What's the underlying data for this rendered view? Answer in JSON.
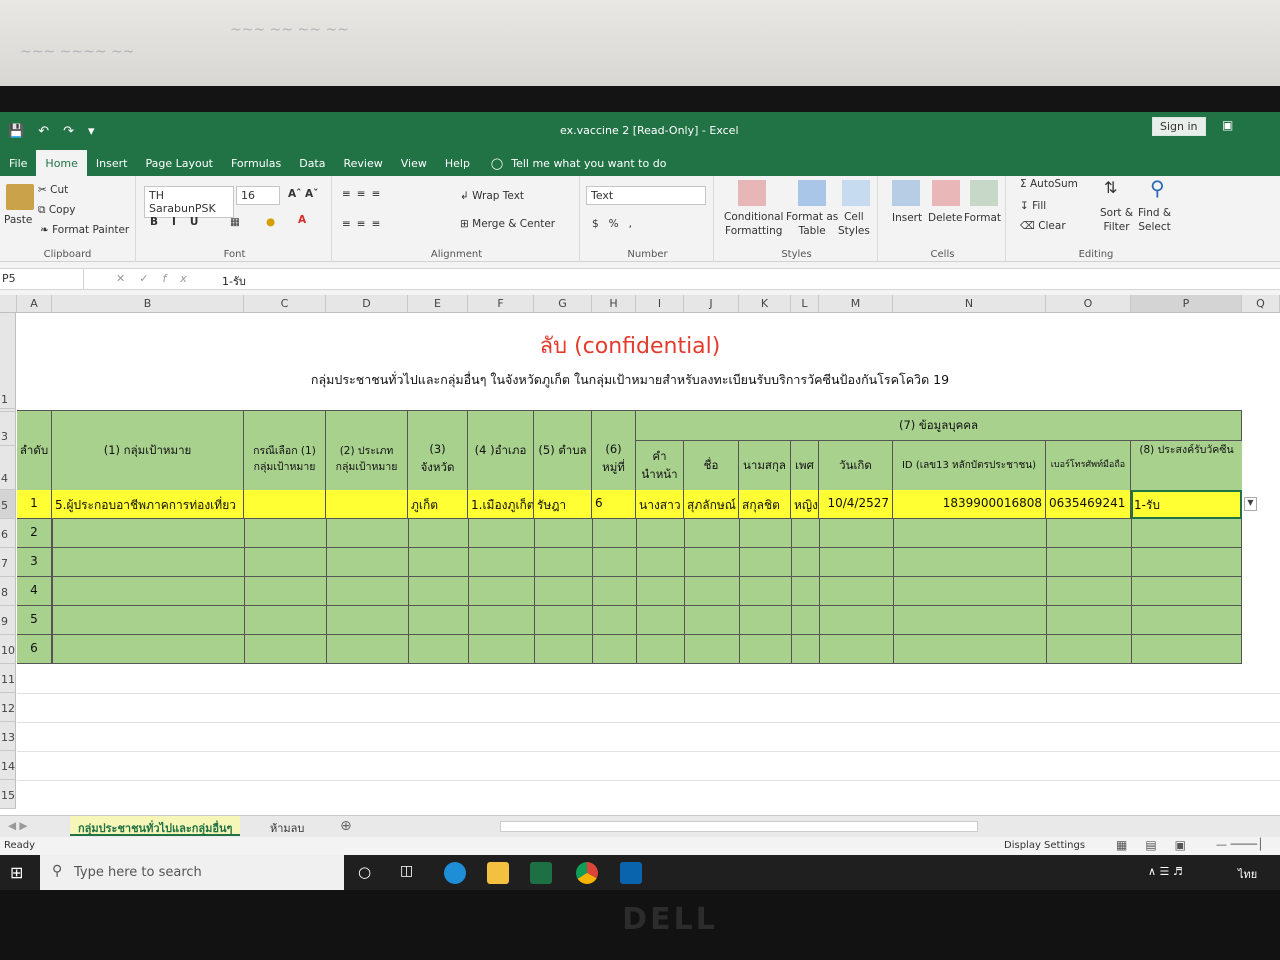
{
  "app": {
    "window_title": "ex.vaccine 2  [Read-Only]  -  Excel",
    "sign_in": "Sign in",
    "tabs": [
      "File",
      "Home",
      "Insert",
      "Page Layout",
      "Formulas",
      "Data",
      "Review",
      "View",
      "Help"
    ],
    "tell_me": "Tell me what you want to do"
  },
  "ribbon": {
    "clipboard": {
      "paste": "Paste",
      "cut": "Cut",
      "copy": "Copy",
      "format_painter": "Format Painter",
      "label": "Clipboard"
    },
    "font": {
      "name": "TH SarabunPSK",
      "size": "16",
      "label": "Font"
    },
    "alignment": {
      "wrap": "Wrap Text",
      "merge": "Merge & Center",
      "label": "Alignment"
    },
    "number": {
      "format": "Text",
      "label": "Number"
    },
    "styles": {
      "conditional_1": "Conditional",
      "conditional_2": "Formatting",
      "format_as_1": "Format as",
      "format_as_2": "Table",
      "cell_1": "Cell",
      "cell_2": "Styles",
      "label": "Styles"
    },
    "cells": {
      "insert": "Insert",
      "delete": "Delete",
      "format": "Format",
      "label": "Cells"
    },
    "editing": {
      "autosum": "AutoSum",
      "fill": "Fill",
      "clear": "Clear",
      "sort_1": "Sort &",
      "sort_2": "Filter",
      "find_1": "Find &",
      "find_2": "Select",
      "label": "Editing"
    }
  },
  "formula_bar": {
    "name_box": "P5",
    "content": "1-รับ"
  },
  "columns": [
    "A",
    "B",
    "C",
    "D",
    "E",
    "F",
    "G",
    "H",
    "I",
    "J",
    "K",
    "L",
    "M",
    "N",
    "O",
    "P",
    "Q"
  ],
  "rows": [
    "1",
    "2",
    "3",
    "4",
    "5",
    "6",
    "7",
    "8",
    "9",
    "10",
    "11",
    "12",
    "13",
    "14",
    "15"
  ],
  "sheet": {
    "title": "ลับ (confidential)",
    "subtitle": "กลุ่มประชาชนทั่วไปและกลุ่มอื่นๆ ในจังหวัดภูเก็ต ในกลุ่มเป้าหมายสำหรับลงทะเบียนรับบริการวัคซีนป้องกันโรคโควิด 19",
    "group_header": "(7) ข้อมูลบุคคล",
    "headers": {
      "order": "ลำดับ",
      "target_group": "(1) กลุ่มเป้าหมาย",
      "choice_1": "กรณีเลือก (1)",
      "choice_2": "กลุ่มเป้าหมาย",
      "type_1": "(2) ประเภท",
      "type_2": "กลุ่มเป้าหมาย",
      "province_1": "(3)",
      "province_2": "จังหวัด",
      "district": "(4 )อำเภอ",
      "subdistrict": "(5) ตำบล",
      "moo_1": "(6)",
      "moo_2": "หมู่ที่",
      "prefix_1": "คำ",
      "prefix_2": "นำหน้า",
      "firstname": "ชื่อ",
      "lastname": "นามสกุล",
      "sex": "เพศ",
      "birthdate": "วันเกิด",
      "id": "ID (เลข13 หลักบัตรประชาชน)",
      "phone": "เบอร์โทรศัพท์มือถือ",
      "intent": "(8) ประสงค์รับวัคซีน"
    },
    "data_row": {
      "order": "1",
      "target_group": "5.ผู้ประกอบอาชีพภาคการท่องเที่ยว",
      "province": "ภูเก็ต",
      "district": "1.เมืองภูเก็ต",
      "subdistrict": "รัษฎา",
      "moo": "6",
      "prefix": "นางสาว",
      "firstname": "สุภลักษณ์",
      "lastname": "สกุลชิต",
      "sex": "หญิง",
      "birthdate": "10/4/2527",
      "id": "1839900016808",
      "phone": "0635469241",
      "intent": "1-รับ"
    },
    "empty_rows": [
      "2",
      "3",
      "4",
      "5",
      "6"
    ]
  },
  "sheet_tabs": [
    "กลุ่มประชาชนทั่วไปและกลุ่มอื่นๆ",
    "ห้ามลบ"
  ],
  "status": {
    "ready": "Ready",
    "display_settings": "Display Settings"
  },
  "taskbar": {
    "search": "Type here to search",
    "lang": "ไทย"
  },
  "colors": {
    "excel_green": "#217346",
    "header_green": "#a9d18e",
    "highlight_yellow": "#ffff33",
    "title_red": "#e53b2c"
  }
}
